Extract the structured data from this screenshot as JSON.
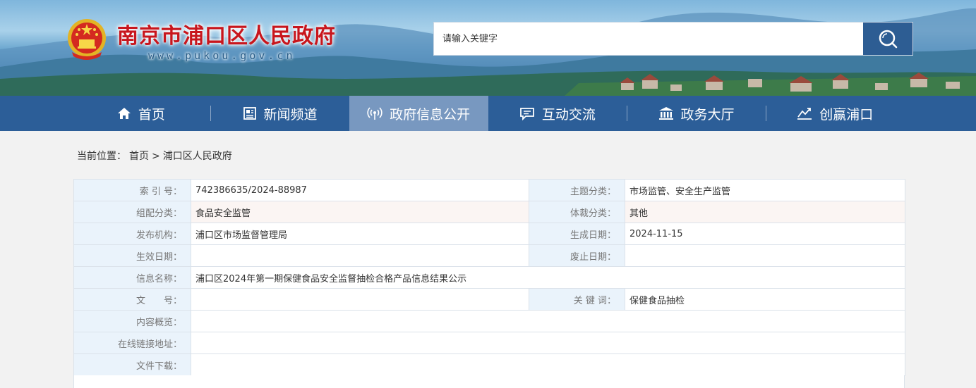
{
  "header": {
    "site_title": "南京市浦口区人民政府",
    "site_domain": "www.pukou.gov.cn",
    "search_placeholder": "请输入关键字"
  },
  "nav": {
    "items": [
      {
        "label": "首页",
        "icon": "home-icon"
      },
      {
        "label": "新闻频道",
        "icon": "newspaper-icon"
      },
      {
        "label": "政府信息公开",
        "icon": "broadcast-icon",
        "active": true
      },
      {
        "label": "互动交流",
        "icon": "chat-icon"
      },
      {
        "label": "政务大厅",
        "icon": "building-icon"
      },
      {
        "label": "创赢浦口",
        "icon": "trend-icon"
      }
    ]
  },
  "breadcrumb": {
    "prefix": "当前位置：",
    "home": "首页",
    "separator": ">",
    "current": "浦口区人民政府"
  },
  "info": {
    "index_label": "索 引 号：",
    "index_value": "742386635/2024-88987",
    "topic_label": "主题分类：",
    "topic_value": "市场监管、安全生产监管",
    "group_label": "组配分类：",
    "group_value": "食品安全监管",
    "genre_label": "体裁分类：",
    "genre_value": "其他",
    "publisher_label": "发布机构：",
    "publisher_value": "浦口区市场监督管理局",
    "created_label": "生成日期：",
    "created_value": "2024-11-15",
    "effective_label": "生效日期：",
    "effective_value": "",
    "abolished_label": "废止日期：",
    "abolished_value": "",
    "title_label": "信息名称：",
    "title_value": "浦口区2024年第一期保健食品安全监督抽检合格产品信息结果公示",
    "docno_label": "文　　号：",
    "docno_value": "",
    "keywords_label": "关 键 词：",
    "keywords_value": "保健食品抽检",
    "summary_label": "内容概览：",
    "summary_value": "",
    "link_label": "在线链接地址：",
    "link_value": "",
    "download_label": "文件下载：",
    "download_value": ""
  },
  "colors": {
    "nav_bg": "#2c5e98",
    "nav_active": "#7898c0",
    "title_red": "#c8161d",
    "label_bg": "#eaf3fb",
    "search_btn": "#2d5d93"
  }
}
